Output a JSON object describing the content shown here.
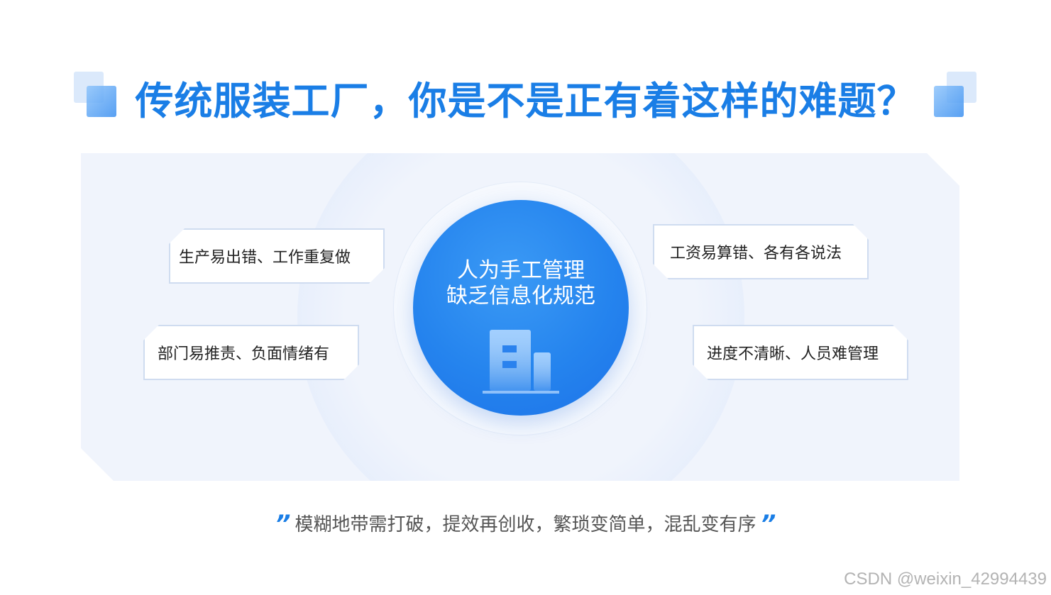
{
  "title": "传统服装工厂，你是不是正有着这样的难题？",
  "center": {
    "line1": "人为手工管理",
    "line2": "缺乏信息化规范"
  },
  "issues": {
    "left_top": "生产易出错、工作重复做",
    "left_bottom": "部门易推责、负面情绪有",
    "right_top": "工资易算错、各有各说法",
    "right_bottom": "进度不清晰、人员难管理"
  },
  "quote": {
    "open": "”",
    "text": "模糊地带需打破，提效再创收，繁琐变简单，混乱变有序",
    "close": "”"
  },
  "watermark": "CSDN @weixin_42994439",
  "colors": {
    "accent": "#1a7ee6",
    "panel_bg": "#f0f4fc",
    "card_border": "#cfdcf0"
  },
  "icons": {
    "title_decoration": "square-blocks-icon",
    "center": "building-icon"
  }
}
